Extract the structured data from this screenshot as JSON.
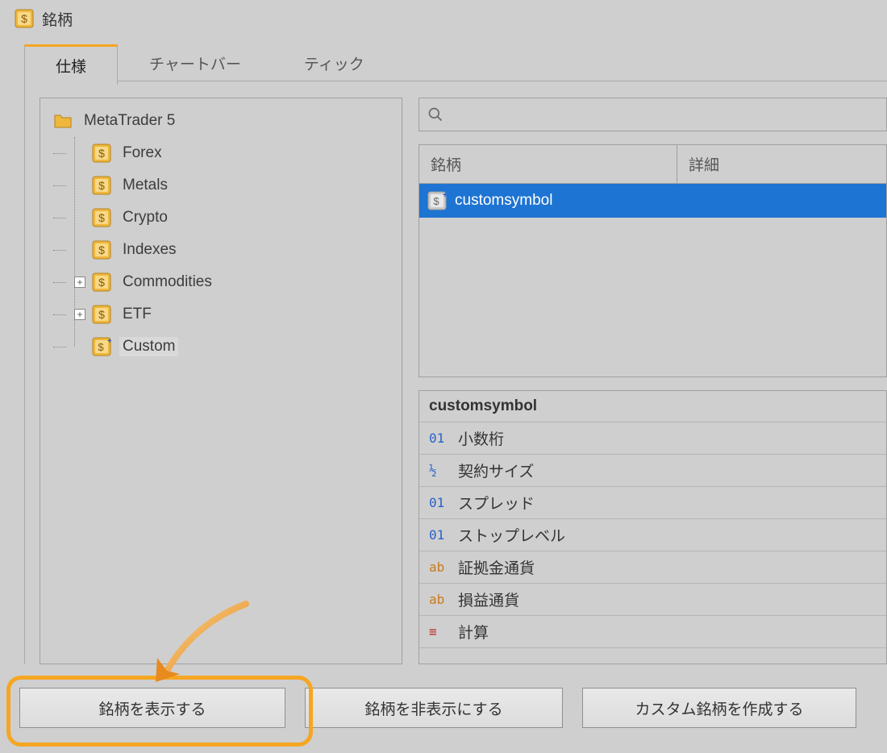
{
  "window": {
    "title": "銘柄"
  },
  "tabs": {
    "spec": "仕様",
    "chart": "チャートバー",
    "tick": "ティック"
  },
  "tree": {
    "root": "MetaTrader 5",
    "items": [
      "Forex",
      "Metals",
      "Crypto",
      "Indexes",
      "Commodities",
      "ETF",
      "Custom"
    ]
  },
  "search": {
    "placeholder": ""
  },
  "list": {
    "col_symbol": "銘柄",
    "col_detail": "詳細",
    "rows": [
      {
        "name": "customsymbol"
      }
    ]
  },
  "props": {
    "title": "customsymbol",
    "rows": [
      {
        "t": "01",
        "label": "小数桁"
      },
      {
        "t": "½",
        "label": "契約サイズ"
      },
      {
        "t": "01",
        "label": "スプレッド"
      },
      {
        "t": "01",
        "label": "ストップレベル"
      },
      {
        "t": "ab",
        "label": "証拠金通貨"
      },
      {
        "t": "ab",
        "label": "損益通貨"
      },
      {
        "t": "≡",
        "label": "計算"
      }
    ]
  },
  "buttons": {
    "show": "銘柄を表示する",
    "hide": "銘柄を非表示にする",
    "create": "カスタム銘柄を作成する"
  }
}
